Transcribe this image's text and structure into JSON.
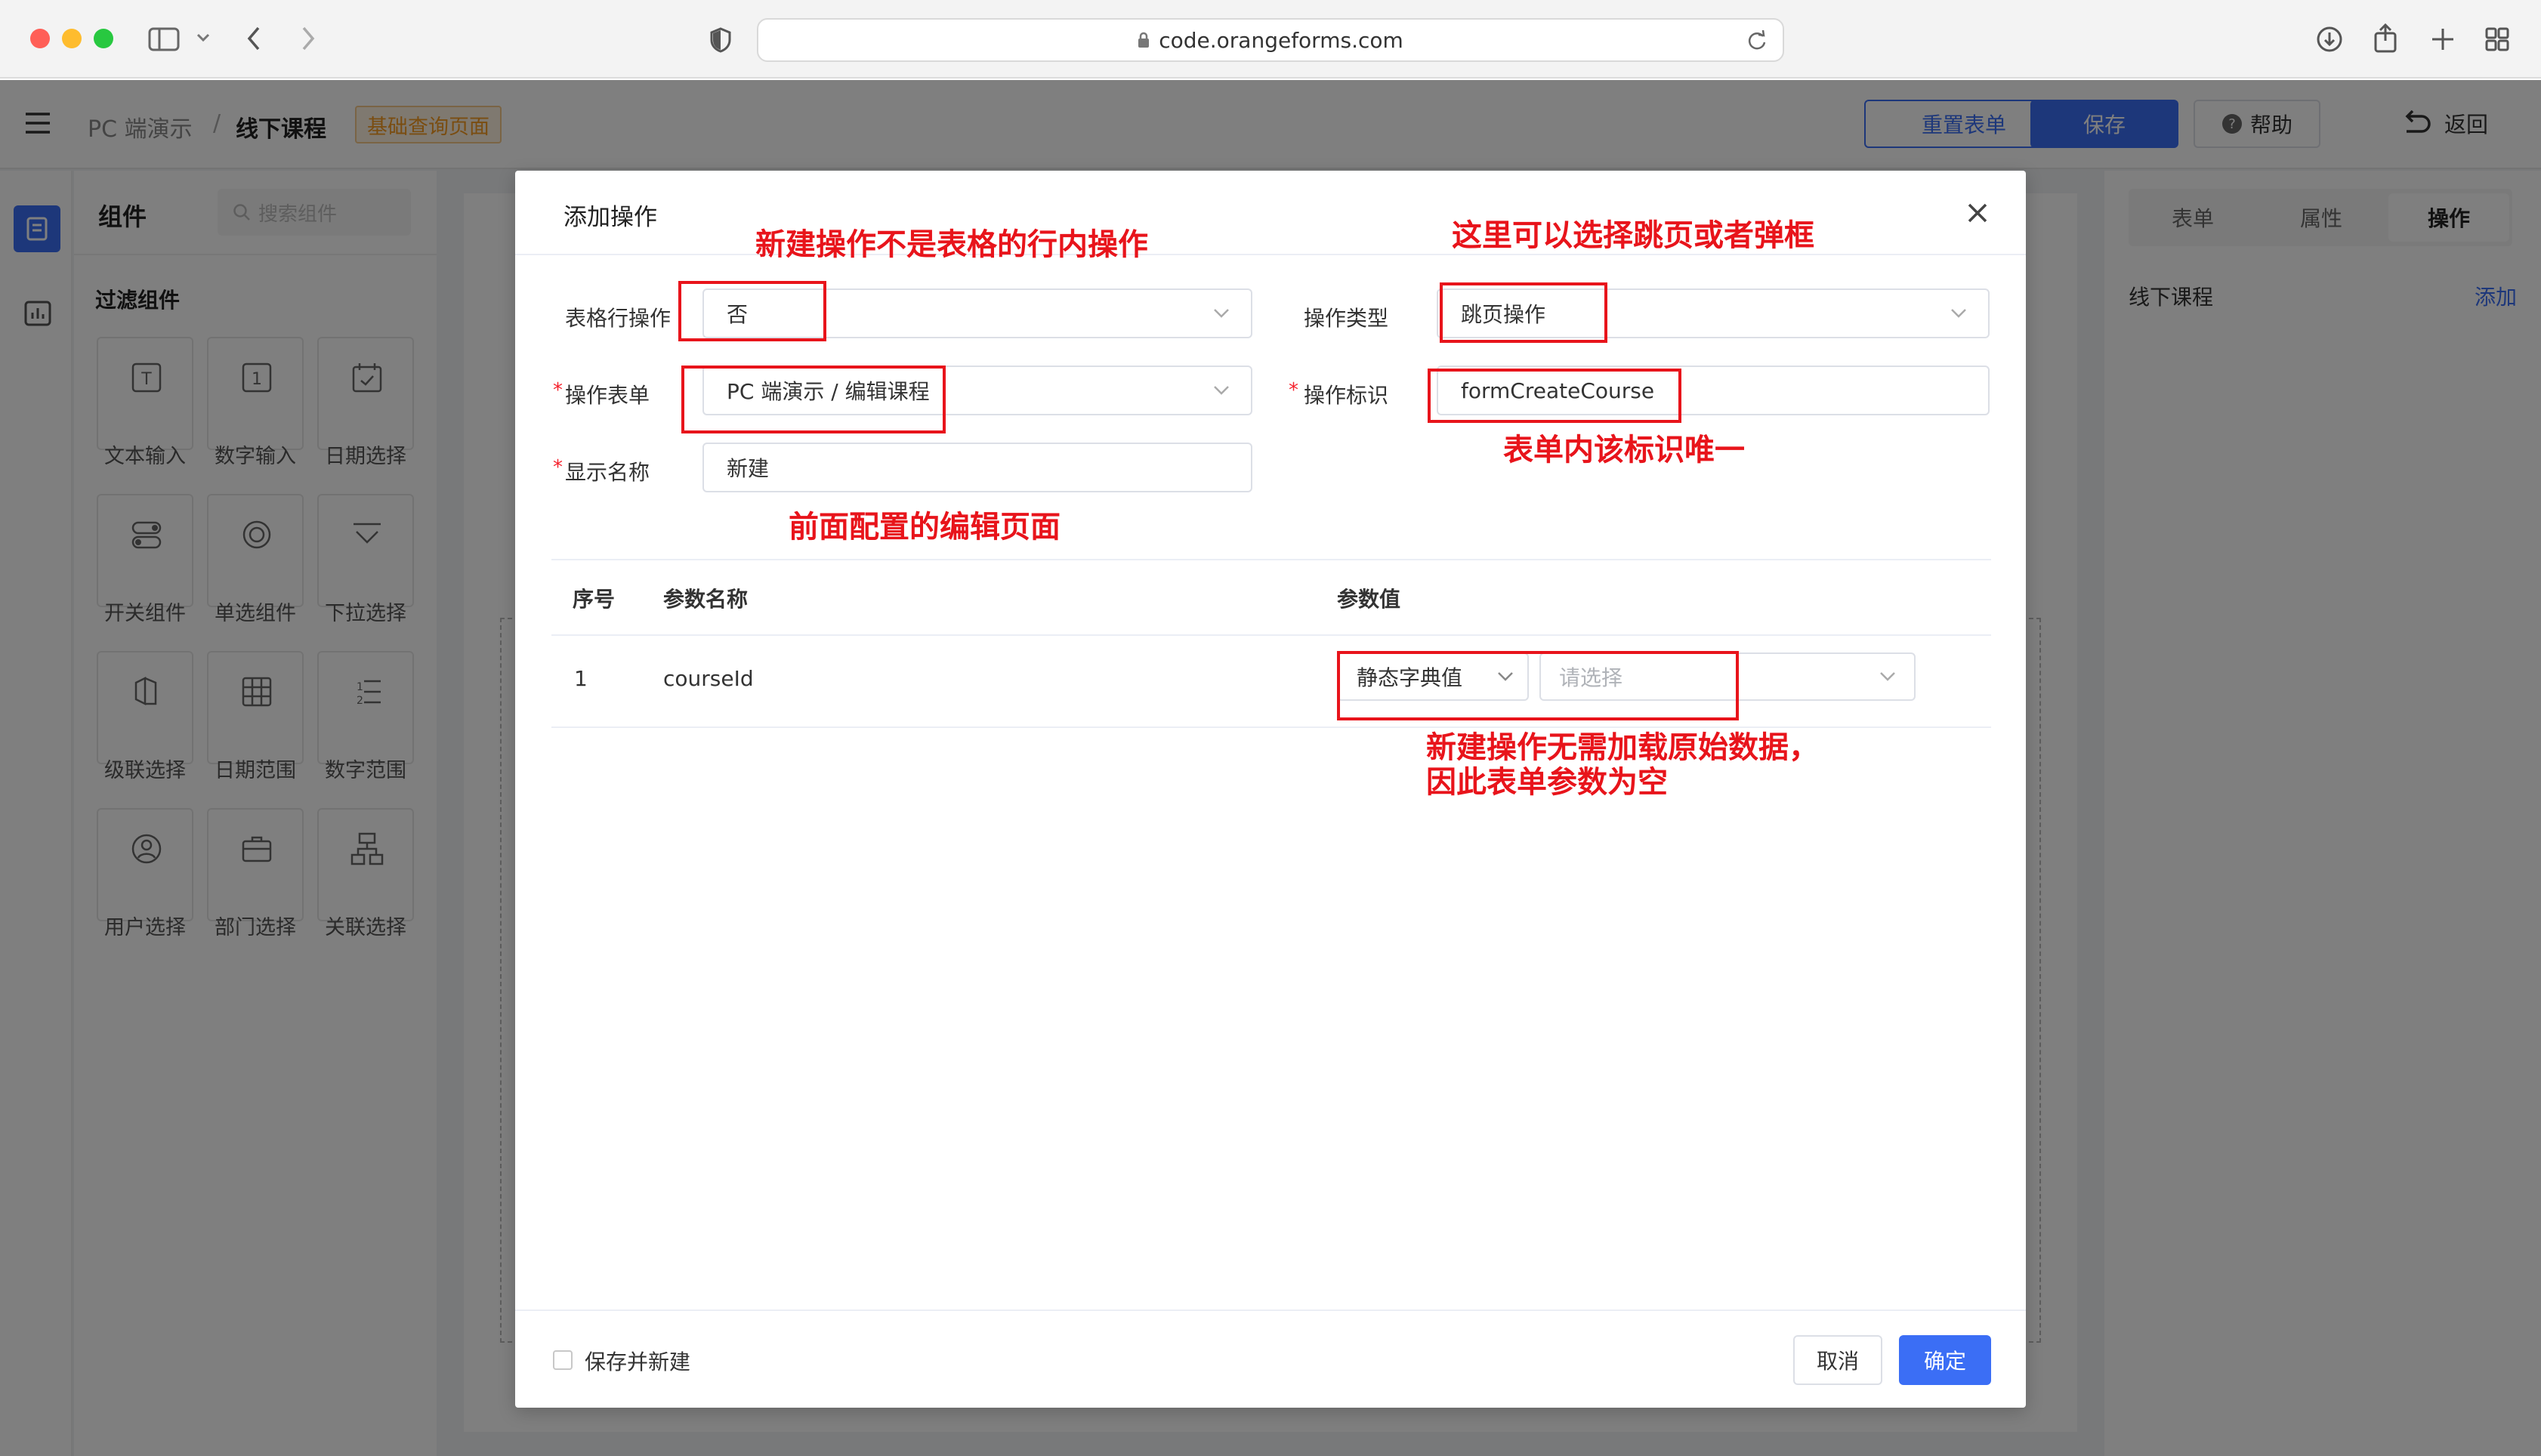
{
  "browser": {
    "url": "code.orangeforms.com"
  },
  "header": {
    "breadcrumb_root": "PC 端演示",
    "breadcrumb_sep": "/",
    "breadcrumb_current": "线下课程",
    "page_tag": "基础查询页面",
    "reset_form": "重置表单",
    "save": "保存",
    "help": "帮助",
    "back": "返回"
  },
  "left_panel": {
    "title": "组件",
    "search_placeholder": "搜索组件",
    "group_title": "过滤组件",
    "components": [
      {
        "label": "文本输入",
        "icon": "text-input-icon"
      },
      {
        "label": "数字输入",
        "icon": "number-input-icon"
      },
      {
        "label": "日期选择",
        "icon": "date-picker-icon"
      },
      {
        "label": "开关组件",
        "icon": "switch-icon"
      },
      {
        "label": "单选组件",
        "icon": "radio-icon"
      },
      {
        "label": "下拉选择",
        "icon": "select-icon"
      },
      {
        "label": "级联选择",
        "icon": "cascader-icon"
      },
      {
        "label": "日期范围",
        "icon": "date-range-icon"
      },
      {
        "label": "数字范围",
        "icon": "number-range-icon"
      },
      {
        "label": "用户选择",
        "icon": "user-select-icon"
      },
      {
        "label": "部门选择",
        "icon": "dept-select-icon"
      },
      {
        "label": "关联选择",
        "icon": "relation-select-icon"
      }
    ]
  },
  "right_panel": {
    "tabs": [
      "表单",
      "属性",
      "操作"
    ],
    "item": "线下课程",
    "add": "添加"
  },
  "modal": {
    "title": "添加操作",
    "row_op_label": "表格行操作",
    "row_op_value": "否",
    "op_type_label": "操作类型",
    "op_type_value": "跳页操作",
    "op_form_label": "操作表单",
    "op_form_value": "PC 端演示 / 编辑课程",
    "op_id_label": "操作标识",
    "op_id_value": "formCreateCourse",
    "display_name_label": "显示名称",
    "display_name_value": "新建",
    "required_mark": "*",
    "table": {
      "headers": [
        "序号",
        "参数名称",
        "参数值"
      ],
      "rows": [
        {
          "index": "1",
          "name": "courseId",
          "value_type": "静态字典值",
          "value_placeholder": "请选择"
        }
      ]
    },
    "save_and_new": "保存并新建",
    "cancel": "取消",
    "confirm": "确定"
  },
  "annotations": {
    "a1": "新建操作不是表格的行内操作",
    "a2": "这里可以选择跳页或者弹框",
    "a3": "表单内该标识唯一",
    "a4": "前面配置的编辑页面",
    "a5_line1": "新建操作无需加载原始数据，",
    "a5_line2": "因此表单参数为空"
  },
  "colors": {
    "primary": "#3b6ef5",
    "annotation": "#e8141b",
    "tag": "#f59a23"
  }
}
